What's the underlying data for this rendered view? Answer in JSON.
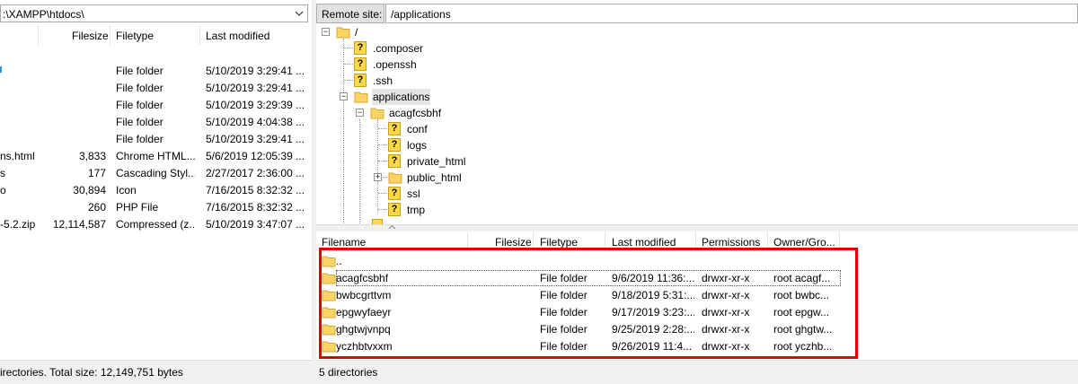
{
  "colors": {
    "highlight": "#e00000",
    "folder": "#fcd461",
    "status_bg": "#f0f0f0"
  },
  "local": {
    "path": ":\\XAMPP\\htdocs\\",
    "columns": {
      "filesize": "Filesize",
      "filetype": "Filetype",
      "last_modified": "Last modified"
    },
    "rows": [
      {
        "name": "",
        "size": "",
        "type": "File folder",
        "modified": "5/10/2019 3:29:41 ..."
      },
      {
        "name": "",
        "size": "",
        "type": "File folder",
        "modified": "5/10/2019 3:29:41 ..."
      },
      {
        "name": "",
        "size": "",
        "type": "File folder",
        "modified": "5/10/2019 3:29:39 ..."
      },
      {
        "name": "",
        "size": "",
        "type": "File folder",
        "modified": "5/10/2019 4:04:38 ..."
      },
      {
        "name": "",
        "size": "",
        "type": "File folder",
        "modified": "5/10/2019 3:29:41 ..."
      },
      {
        "name": "ns.html",
        "size": "3,833",
        "type": "Chrome HTML...",
        "modified": "5/6/2019 12:05:39 ..."
      },
      {
        "name": "s",
        "size": "177",
        "type": "Cascading Styl...",
        "modified": "2/27/2017 2:36:00 ..."
      },
      {
        "name": "o",
        "size": "30,894",
        "type": "Icon",
        "modified": "7/16/2015 8:32:32 ..."
      },
      {
        "name": "",
        "size": "260",
        "type": "PHP File",
        "modified": "7/16/2015 8:32:32 ..."
      },
      {
        "name": "-5.2.zip",
        "size": "12,114,587",
        "type": "Compressed (z...",
        "modified": "5/10/2019 3:47:07 ..."
      }
    ],
    "status": "irectories. Total size: 12,149,751 bytes"
  },
  "remote": {
    "label": "Remote site:",
    "path": "/applications",
    "tree": {
      "root": "/",
      "composer": ".composer",
      "openssh": ".openssh",
      "ssh": ".ssh",
      "applications": "applications",
      "acagfcsbhf": "acagfcsbhf",
      "conf": "conf",
      "logs": "logs",
      "private_html": "private_html",
      "public_html": "public_html",
      "ssl": "ssl",
      "tmp": "tmp"
    },
    "columns": {
      "filename": "Filename",
      "filesize": "Filesize",
      "filetype": "Filetype",
      "last_modified": "Last modified",
      "permissions": "Permissions",
      "owner_group": "Owner/Gro..."
    },
    "parent_row": "..",
    "rows": [
      {
        "name": "acagfcsbhf",
        "type": "File folder",
        "modified": "9/6/2019 11:36:...",
        "perms": "drwxr-xr-x",
        "owner": "root acagf..."
      },
      {
        "name": "bwbcgrttvm",
        "type": "File folder",
        "modified": "9/18/2019 5:31:...",
        "perms": "drwxr-xr-x",
        "owner": "root bwbc..."
      },
      {
        "name": "epgwyfaeyr",
        "type": "File folder",
        "modified": "9/17/2019 3:23:...",
        "perms": "drwxr-xr-x",
        "owner": "root epgw..."
      },
      {
        "name": "ghgtwjvnpq",
        "type": "File folder",
        "modified": "9/25/2019 2:28:...",
        "perms": "drwxr-xr-x",
        "owner": "root ghgtw..."
      },
      {
        "name": "yczhbtvxxm",
        "type": "File folder",
        "modified": "9/26/2019 11:4...",
        "perms": "drwxr-xr-x",
        "owner": "root yczhb..."
      }
    ],
    "status": "5 directories"
  }
}
